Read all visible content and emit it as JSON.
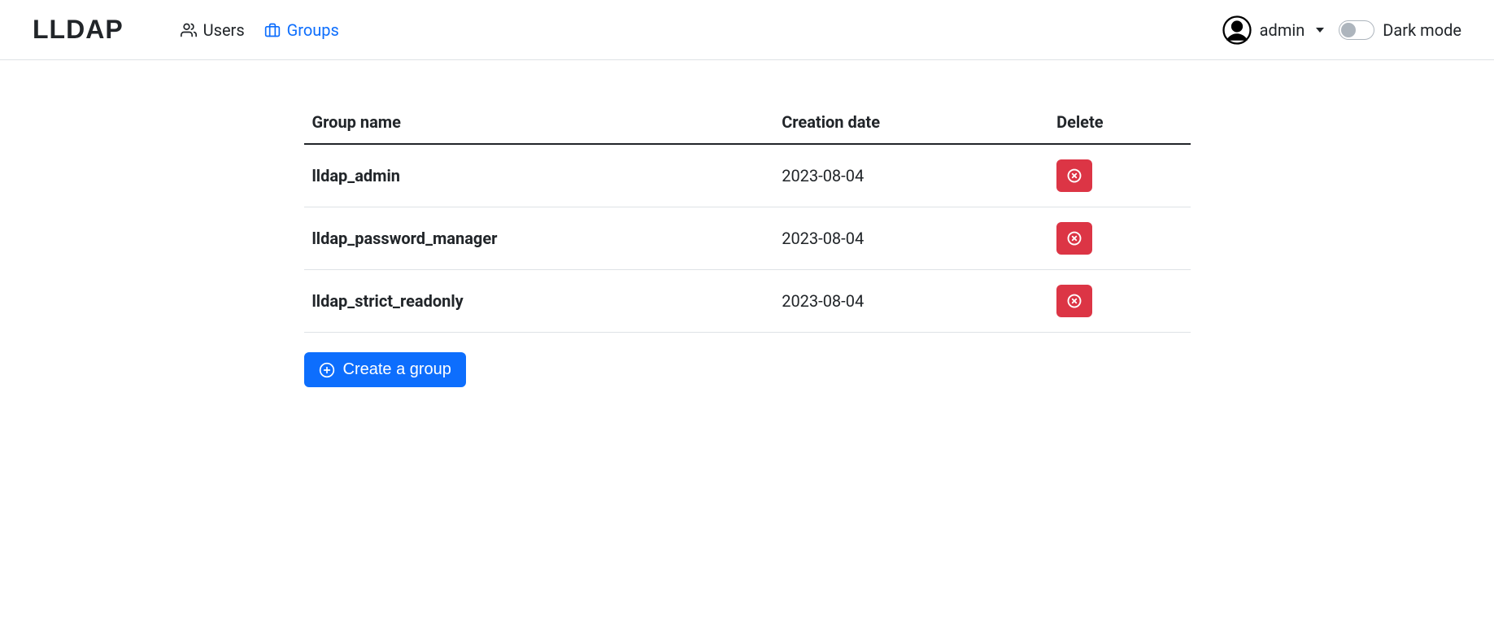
{
  "brand": "LLDAP",
  "nav": {
    "users_label": "Users",
    "groups_label": "Groups"
  },
  "user": {
    "name": "admin"
  },
  "dark_mode_label": "Dark mode",
  "table": {
    "headers": {
      "name": "Group name",
      "date": "Creation date",
      "delete": "Delete"
    },
    "rows": [
      {
        "name": "lldap_admin",
        "date": "2023-08-04"
      },
      {
        "name": "lldap_password_manager",
        "date": "2023-08-04"
      },
      {
        "name": "lldap_strict_readonly",
        "date": "2023-08-04"
      }
    ]
  },
  "create_button_label": "Create a group"
}
